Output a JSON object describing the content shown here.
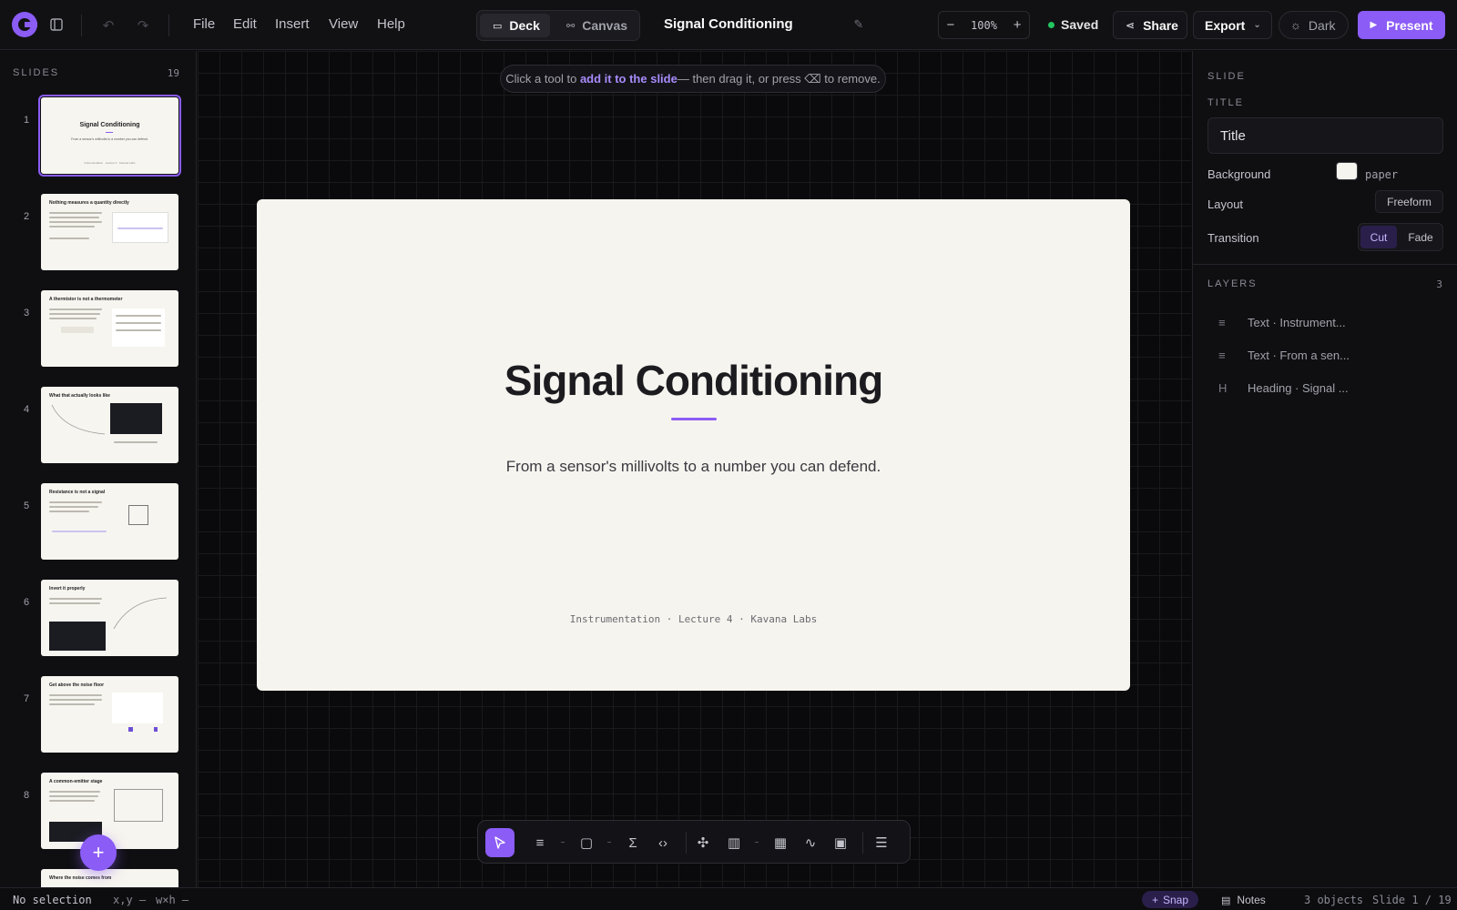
{
  "menu": {
    "file": "File",
    "edit": "Edit",
    "insert": "Insert",
    "view": "View",
    "help": "Help"
  },
  "mode": {
    "deck": "Deck",
    "canvas": "Canvas"
  },
  "doc_title": "Signal Conditioning",
  "zoom": {
    "minus": "−",
    "value": "100%",
    "plus": "+"
  },
  "status_saved": "Saved",
  "share": "Share",
  "export": "Export",
  "theme": "Dark",
  "present": "Present",
  "sidebar": {
    "header": "SLIDES",
    "count": "19",
    "add": "+",
    "slides": [
      {
        "num": "1",
        "title": "Signal Conditioning",
        "sub": "From a sensor's millivolts to a number you can defend.",
        "foot": "Instrumentation · Lecture 4 · Kavana Labs"
      },
      {
        "num": "2",
        "title": "Nothing measures a quantity directly"
      },
      {
        "num": "3",
        "title": "A thermistor is not a thermometer"
      },
      {
        "num": "4",
        "title": "What that actually looks like"
      },
      {
        "num": "5",
        "title": "Resistance is not a signal"
      },
      {
        "num": "6",
        "title": "Invert it properly"
      },
      {
        "num": "7",
        "title": "Get above the noise floor"
      },
      {
        "num": "8",
        "title": "A common-emitter stage"
      },
      {
        "num": "9",
        "title": "Where the noise comes from"
      }
    ]
  },
  "hint": {
    "pre": "Click a tool to ",
    "bold": "add it to the slide",
    "post": " — then drag it, or press ⌫ to remove."
  },
  "slide": {
    "title": "Signal Conditioning",
    "subtitle": "From a sensor's millivolts to a number you can defend.",
    "footer": "Instrumentation · Lecture 4 · Kavana Labs"
  },
  "panel": {
    "slide_head": "SLIDE",
    "title_head": "TITLE",
    "title_value": "Title",
    "background_label": "Background",
    "background_value": "paper",
    "layout_label": "Layout",
    "layout_value": "Freeform",
    "transition_label": "Transition",
    "transition_cut": "Cut",
    "transition_fade": "Fade",
    "layers_head": "LAYERS",
    "layers_count": "3",
    "layers": [
      {
        "icon": "≡",
        "label": "Text · Instrument..."
      },
      {
        "icon": "≡",
        "label": "Text · From a sen..."
      },
      {
        "icon": "H",
        "label": "Heading · Signal ..."
      }
    ]
  },
  "status": {
    "selection": "No selection",
    "xy": "x,y —",
    "wh": "w×h —",
    "snap": "Snap",
    "notes": "Notes",
    "objects": "3 objects",
    "slide": "Slide 1 / 19"
  },
  "colors": {
    "accent": "#8b5cf6",
    "paper": "#f6f4ef",
    "saved_dot": "#22c55e"
  }
}
